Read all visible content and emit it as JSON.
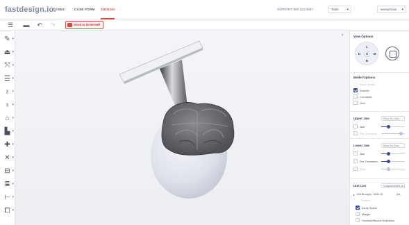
{
  "app": {
    "logo": "fastdesign.io.",
    "nav": [
      {
        "label": "CASES"
      },
      {
        "label": "CASE FORM"
      },
      {
        "label": "DESIGN"
      }
    ],
    "support": "SUPPORT: 800-123-4567",
    "tools_dropdown": "Tools",
    "user_dropdown": "anonymous"
  },
  "toolbar": {
    "send_label": "Send to Orderwell",
    "icons": [
      "menu-icon",
      "film-icon",
      "undo-icon",
      "redo-icon"
    ]
  },
  "left_tools": [
    {
      "icon": "edit-icon",
      "glyph": "✎"
    },
    {
      "icon": "margin-icon",
      "glyph": "⏏"
    },
    {
      "icon": "scale-icon",
      "glyph": "⤧"
    },
    {
      "icon": "layers-icon",
      "glyph": "☰"
    },
    {
      "icon": "tooth-1-icon",
      "glyph": "♁"
    },
    {
      "icon": "tooth-2-icon",
      "glyph": "♁"
    },
    {
      "icon": "crown-icon",
      "glyph": "⌂"
    },
    {
      "icon": "boot-icon",
      "glyph": "▙"
    },
    {
      "icon": "grid-icon",
      "glyph": "✚"
    },
    {
      "icon": "tools-icon",
      "glyph": "✕"
    },
    {
      "icon": "bridge-icon",
      "glyph": "⊟"
    },
    {
      "icon": "list-icon",
      "glyph": "≣"
    },
    {
      "icon": "connector-icon",
      "glyph": "⊢"
    },
    {
      "icon": "abutment-icon",
      "glyph": "⧠"
    }
  ],
  "view_options": {
    "title": "View Options",
    "buttons": {
      "top": "L",
      "left": "D",
      "center": "O",
      "right": "M",
      "bottom": "B"
    }
  },
  "model_options": {
    "title": "Model Options",
    "items": [
      {
        "label": "Show Model",
        "checked": false,
        "muted": true
      },
      {
        "label": "Smooth",
        "checked": true,
        "muted": false
      },
      {
        "label": "Curvature",
        "checked": false,
        "muted": false
      },
      {
        "label": "Grid",
        "checked": false,
        "muted": false
      }
    ]
  },
  "upper_jaw": {
    "title": "Upper Jaw",
    "dropdown": "Show Pre-Occlu...",
    "rows": [
      {
        "label": "Jaw",
        "checked": false,
        "muted": false,
        "level": 0.3
      },
      {
        "label": "Pre-Occlusion",
        "checked": false,
        "muted": true,
        "level": 0.85
      }
    ]
  },
  "lower_jaw": {
    "title": "Lower Jaw",
    "dropdown": "Show Pre-Occlu...",
    "rows": [
      {
        "label": "Jaw",
        "checked": false,
        "muted": false,
        "level": 0.3
      },
      {
        "label": "Pre-Treatment",
        "checked": false,
        "muted": false,
        "level": 0.3
      },
      {
        "label": "Scan",
        "checked": false,
        "muted": true,
        "level": 0.3
      }
    ]
  },
  "unit_list": {
    "title": "Unit List",
    "dropdown": "Collapse/Expand All",
    "unit": "#15 Bicuspid - MOD-15",
    "unit_tag": "Ant.",
    "sub_label": "Position",
    "items": [
      {
        "label": "Block Spline",
        "checked": true
      },
      {
        "label": "Margin",
        "checked": false
      },
      {
        "label": "Occlusal/Buccal Directions",
        "checked": false
      }
    ]
  },
  "colors": {
    "accent": "#e0483e",
    "primary": "#3a4a9c",
    "model_gray": "#6d6e72"
  }
}
